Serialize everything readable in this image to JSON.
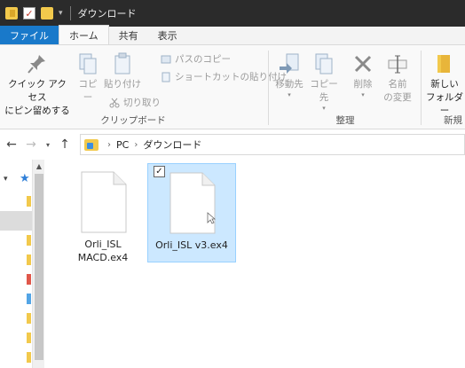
{
  "window": {
    "title": "ダウンロード"
  },
  "tabs": {
    "file": "ファイル",
    "home": "ホーム",
    "share": "共有",
    "view": "表示"
  },
  "ribbon": {
    "clipboard": {
      "label": "クリップボード",
      "pin_line1": "クイック アクセス",
      "pin_line2": "にピン留めする",
      "copy": "コピー",
      "paste": "貼り付け",
      "copy_path": "パスのコピー",
      "paste_shortcut": "ショートカットの貼り付け",
      "cut": "切り取り"
    },
    "organize": {
      "label": "整理",
      "move_to": "移動先",
      "copy_to": "コピー先",
      "delete": "削除",
      "rename_line1": "名前",
      "rename_line2": "の変更"
    },
    "new": {
      "label": "新規",
      "new_folder_line1": "新しい",
      "new_folder_line2": "フォルダー"
    }
  },
  "address": {
    "crumbs": [
      "PC",
      "ダウンロード"
    ],
    "separator": "›"
  },
  "files": [
    {
      "line1": "Orli_ISL",
      "line2": "MACD.ex4",
      "selected": false,
      "icon": "document-icon"
    },
    {
      "line1": "Orli_ISL v3.ex4",
      "line2": "",
      "selected": true,
      "icon": "document-icon"
    }
  ],
  "colors": {
    "accent": "#1979ca",
    "selection": "#cce8ff",
    "folder": "#f2c94c"
  }
}
